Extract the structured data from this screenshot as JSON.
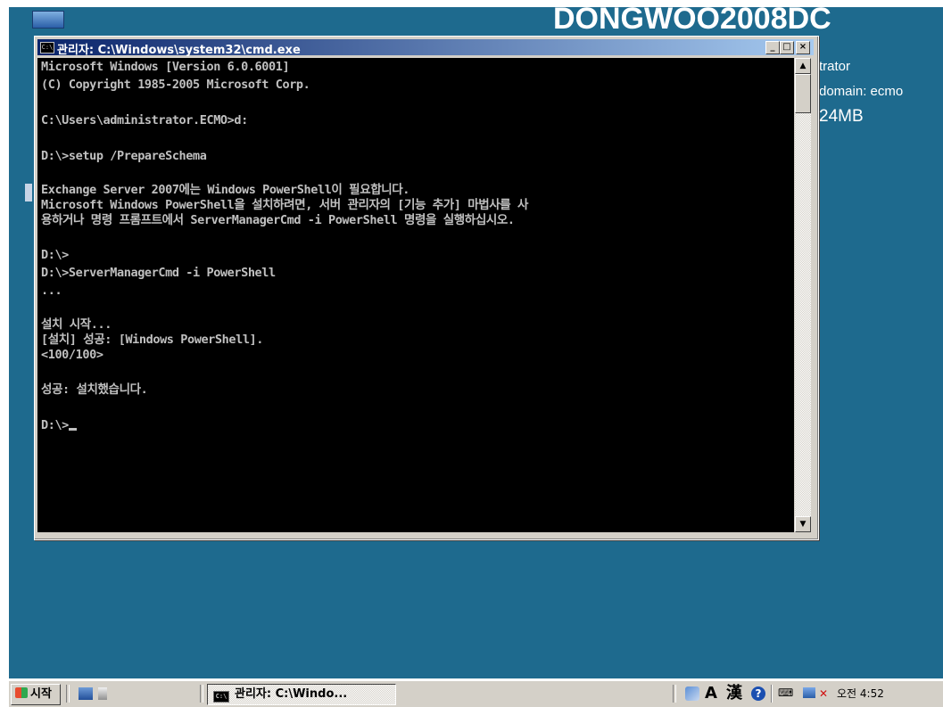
{
  "desktop": {
    "wallpaper_title": "DONGWOO2008DC",
    "bginfo_lines": [
      "trator",
      "domain: ecmo",
      "24MB"
    ]
  },
  "window": {
    "title": "관리자: C:\\Windows\\system32\\cmd.exe",
    "icon_label": "C:\\",
    "buttons": {
      "minimize": "_",
      "maximize": "□",
      "close": "×"
    }
  },
  "console": {
    "lines": [
      "Microsoft Windows [Version 6.0.6001]",
      "(C) Copyright 1985-2005 Microsoft Corp.",
      "",
      "C:\\Users\\administrator.ECMO>d:",
      "",
      "D:\\>setup /PrepareSchema",
      "",
      "Exchange Server 2007에는 Windows PowerShell이 필요합니다.",
      "Microsoft Windows PowerShell을 설치하려면, 서버 관리자의 [기능 추가] 마법사를 사",
      "용하거나 명령 프롬프트에서 ServerManagerCmd -i PowerShell 명령을 실행하십시오.",
      "",
      "D:\\>",
      "D:\\>ServerManagerCmd -i PowerShell",
      "...",
      "",
      "설치 시작...",
      "[설치] 성공: [Windows PowerShell].",
      "<100/100>",
      "",
      "성공: 설치했습니다.",
      "",
      "D:\\>"
    ]
  },
  "taskbar": {
    "start_label": "시작",
    "task_button_label": "관리자: C:\\Windo...",
    "task_icon_label": "C:\\",
    "tray": {
      "lang_a": "A",
      "lang_hanja": "漢",
      "help": "?",
      "clock": "오전 4:52"
    }
  }
}
